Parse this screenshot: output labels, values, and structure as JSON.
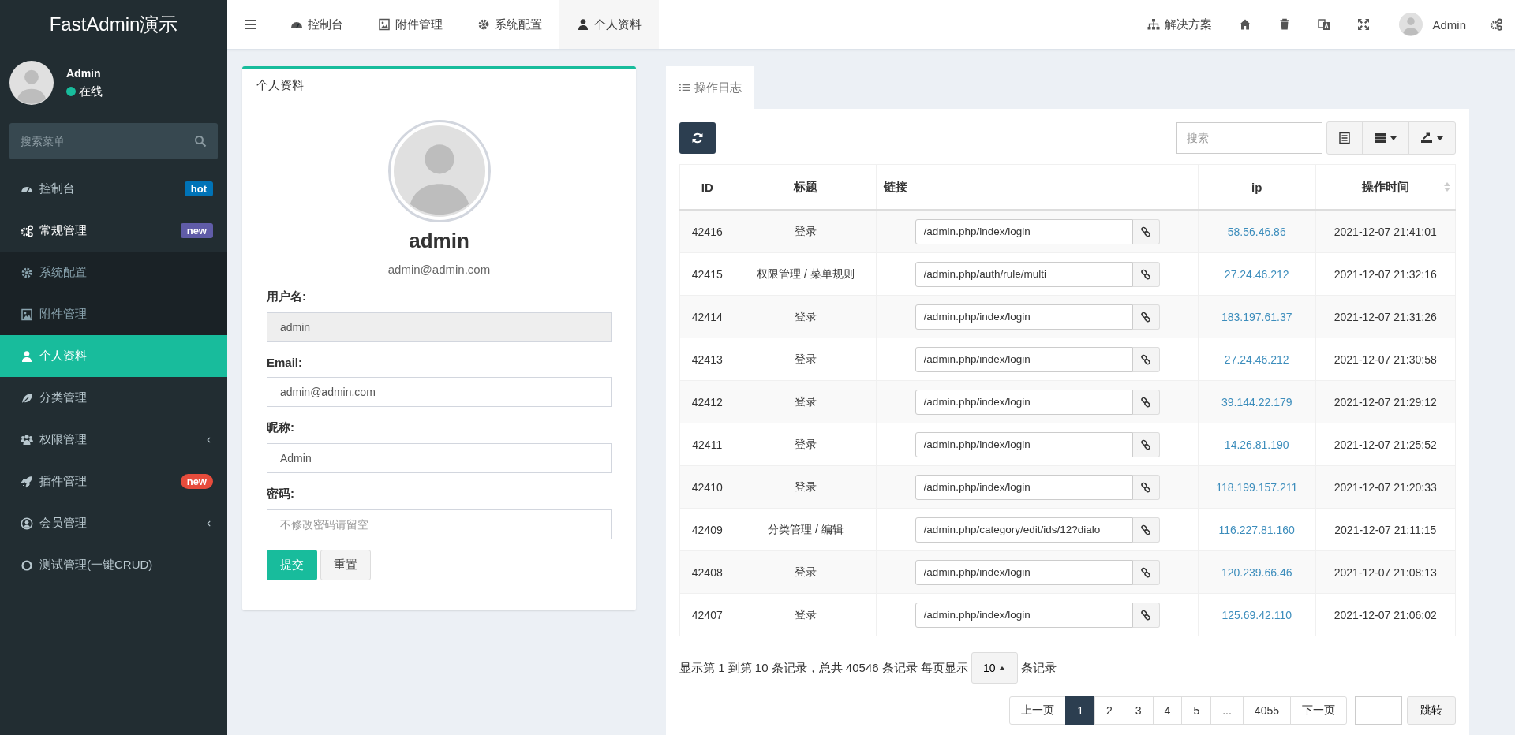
{
  "sidebar": {
    "logo": "FastAdmin演示",
    "user": {
      "name": "Admin",
      "status": "在线"
    },
    "search": {
      "placeholder": "搜索菜单"
    },
    "items": [
      {
        "label": "控制台",
        "selected": false,
        "badge": {
          "text": "hot",
          "color": "#0073b7",
          "kind": "label"
        }
      },
      {
        "label": "常规管理",
        "selected": false,
        "expanded": true,
        "badge": {
          "text": "new",
          "color": "#605ca8",
          "kind": "label"
        },
        "children": [
          {
            "label": "系统配置",
            "selected": false
          },
          {
            "label": "附件管理",
            "selected": false
          }
        ]
      },
      {
        "label": "个人资料",
        "selected": true
      },
      {
        "label": "分类管理",
        "selected": false
      },
      {
        "label": "权限管理",
        "selected": false,
        "expanded": false
      },
      {
        "label": "插件管理",
        "selected": false,
        "badge": {
          "text": "new",
          "color": "#e74c3c",
          "kind": "pill"
        }
      },
      {
        "label": "会员管理",
        "selected": false,
        "expanded": false
      },
      {
        "label": "测试管理(一键CRUD)",
        "selected": false
      }
    ]
  },
  "header": {
    "tabs": [
      {
        "label": "控制台",
        "selected": false
      },
      {
        "label": "附件管理",
        "selected": false
      },
      {
        "label": "系统配置",
        "selected": false
      },
      {
        "label": "个人资料",
        "selected": true
      }
    ],
    "solution": "解决方案",
    "user": "Admin"
  },
  "profile": {
    "title": "个人资料",
    "username": "admin",
    "email": "admin@admin.com",
    "fields": [
      {
        "label": "用户名:",
        "value": "admin",
        "disabled": true
      },
      {
        "label": "Email:",
        "value": "admin@admin.com",
        "disabled": false
      },
      {
        "label": "昵称:",
        "value": "Admin",
        "disabled": false
      },
      {
        "label": "密码:",
        "placeholder": "不修改密码请留空",
        "disabled": false
      }
    ],
    "buttons": [
      {
        "label": "提交",
        "kind": "primary"
      },
      {
        "label": "重置",
        "kind": "default"
      }
    ]
  },
  "log": {
    "tab": {
      "label": "操作日志",
      "selected": true
    },
    "search": {
      "placeholder": "搜索"
    },
    "table": {
      "columns": [
        {
          "label": "ID"
        },
        {
          "label": "标题"
        },
        {
          "label": "链接"
        },
        {
          "label": "ip"
        },
        {
          "label": "操作时间",
          "sortable": true
        }
      ],
      "rows": [
        {
          "id": "42416",
          "title": "登录",
          "url": "/admin.php/index/login",
          "ip": "58.56.46.86",
          "time": "2021-12-07 21:41:01"
        },
        {
          "id": "42415",
          "title": "权限管理 / 菜单规则",
          "url": "/admin.php/auth/rule/multi",
          "ip": "27.24.46.212",
          "time": "2021-12-07 21:32:16"
        },
        {
          "id": "42414",
          "title": "登录",
          "url": "/admin.php/index/login",
          "ip": "183.197.61.37",
          "time": "2021-12-07 21:31:26"
        },
        {
          "id": "42413",
          "title": "登录",
          "url": "/admin.php/index/login",
          "ip": "27.24.46.212",
          "time": "2021-12-07 21:30:58"
        },
        {
          "id": "42412",
          "title": "登录",
          "url": "/admin.php/index/login",
          "ip": "39.144.22.179",
          "time": "2021-12-07 21:29:12"
        },
        {
          "id": "42411",
          "title": "登录",
          "url": "/admin.php/index/login",
          "ip": "14.26.81.190",
          "time": "2021-12-07 21:25:52"
        },
        {
          "id": "42410",
          "title": "登录",
          "url": "/admin.php/index/login",
          "ip": "118.199.157.211",
          "time": "2021-12-07 21:20:33"
        },
        {
          "id": "42409",
          "title": "分类管理 / 编辑",
          "url": "/admin.php/category/edit/ids/12?dialo",
          "ip": "116.227.81.160",
          "time": "2021-12-07 21:11:15"
        },
        {
          "id": "42408",
          "title": "登录",
          "url": "/admin.php/index/login",
          "ip": "120.239.66.46",
          "time": "2021-12-07 21:08:13"
        },
        {
          "id": "42407",
          "title": "登录",
          "url": "/admin.php/index/login",
          "ip": "125.69.42.110",
          "time": "2021-12-07 21:06:02"
        }
      ]
    },
    "summary": {
      "before": "显示第 1 到第 10 条记录，总共 40546 条记录 每页显示",
      "page_size": "10",
      "after": "条记录"
    },
    "pagination": {
      "pages": [
        {
          "label": "上一页",
          "selected": false
        },
        {
          "label": "1",
          "selected": true
        },
        {
          "label": "2",
          "selected": false
        },
        {
          "label": "3",
          "selected": false
        },
        {
          "label": "4",
          "selected": false
        },
        {
          "label": "5",
          "selected": false
        },
        {
          "label": "...",
          "selected": false
        },
        {
          "label": "4055",
          "selected": false
        },
        {
          "label": "下一页",
          "selected": false
        }
      ],
      "jump": "跳转"
    }
  }
}
